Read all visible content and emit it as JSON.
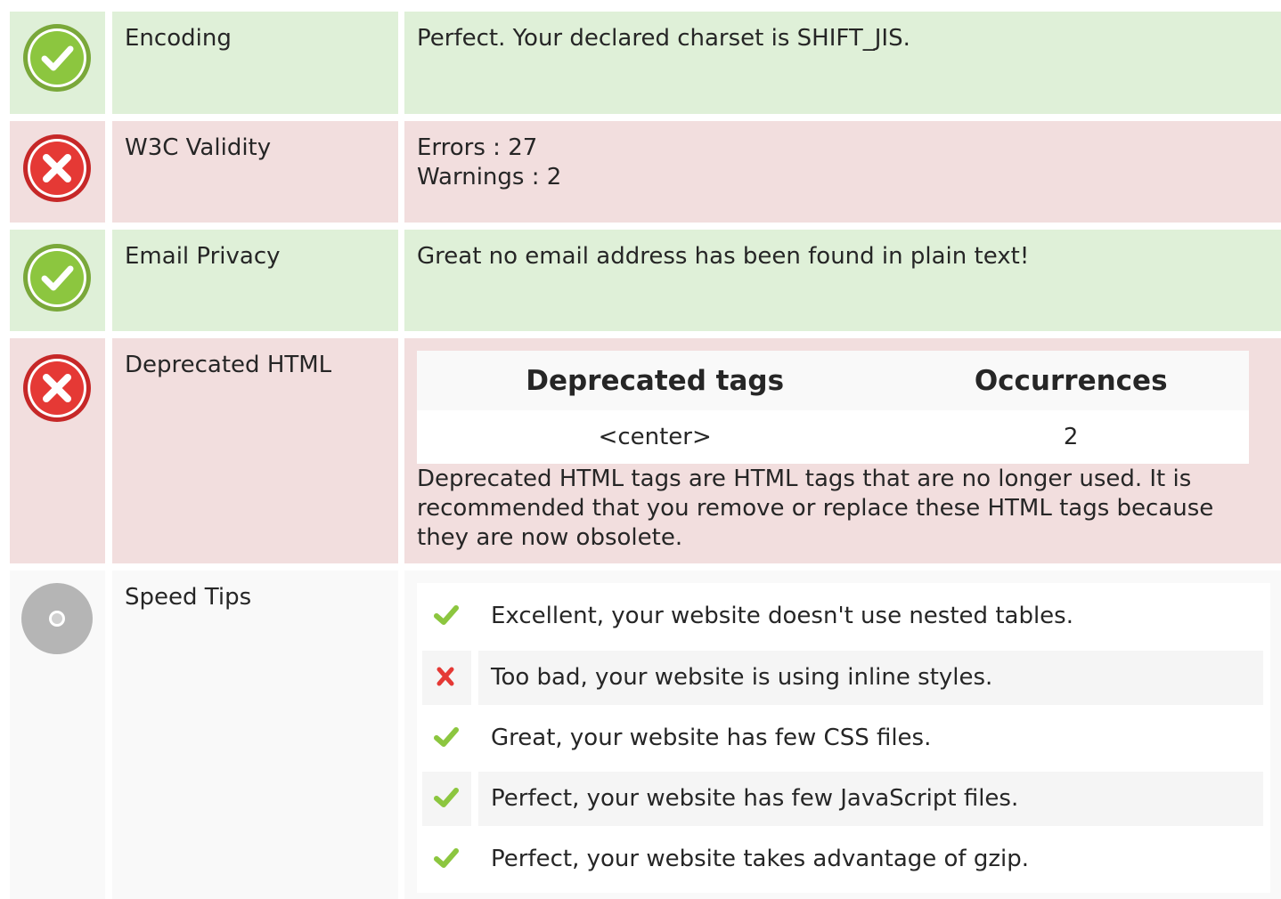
{
  "rows": [
    {
      "status": "good",
      "icon": "check-circle-icon",
      "label": "Encoding",
      "value": "Perfect. Your declared charset is SHIFT_JIS."
    },
    {
      "status": "bad",
      "icon": "cross-circle-icon",
      "label": "W3C Validity",
      "value_lines": [
        "Errors : 27",
        "Warnings : 2"
      ]
    },
    {
      "status": "good",
      "icon": "check-circle-icon",
      "label": "Email Privacy",
      "value": "Great no email address has been found in plain text!"
    },
    {
      "status": "bad",
      "icon": "cross-circle-icon",
      "label": "Deprecated HTML",
      "table": {
        "headers": [
          "Deprecated tags",
          "Occurrences"
        ],
        "rows": [
          [
            "<center>",
            "2"
          ]
        ]
      },
      "description": "Deprecated HTML tags are HTML tags that are no longer used. It is recommended that you remove or replace these HTML tags because they are now obsolete."
    },
    {
      "status": "neutral",
      "icon": "neutral-circle-icon",
      "label": "Speed Tips",
      "tips": [
        {
          "ok": true,
          "icon": "checkmark-icon",
          "text": "Excellent, your website doesn't use nested tables."
        },
        {
          "ok": false,
          "icon": "cross-icon",
          "text": "Too bad, your website is using inline styles."
        },
        {
          "ok": true,
          "icon": "checkmark-icon",
          "text": "Great, your website has few CSS files."
        },
        {
          "ok": true,
          "icon": "checkmark-icon",
          "text": "Perfect, your website has few JavaScript files."
        },
        {
          "ok": true,
          "icon": "checkmark-icon",
          "text": "Perfect, your website takes advantage of gzip."
        }
      ]
    }
  ],
  "colors": {
    "good_bg": "#dff0d8",
    "bad_bg": "#f2dede",
    "neutral_bg": "#f9f9f9",
    "check_green": "#8cc63f",
    "cross_red": "#e53935",
    "neutral_gray": "#bdbdbd"
  }
}
